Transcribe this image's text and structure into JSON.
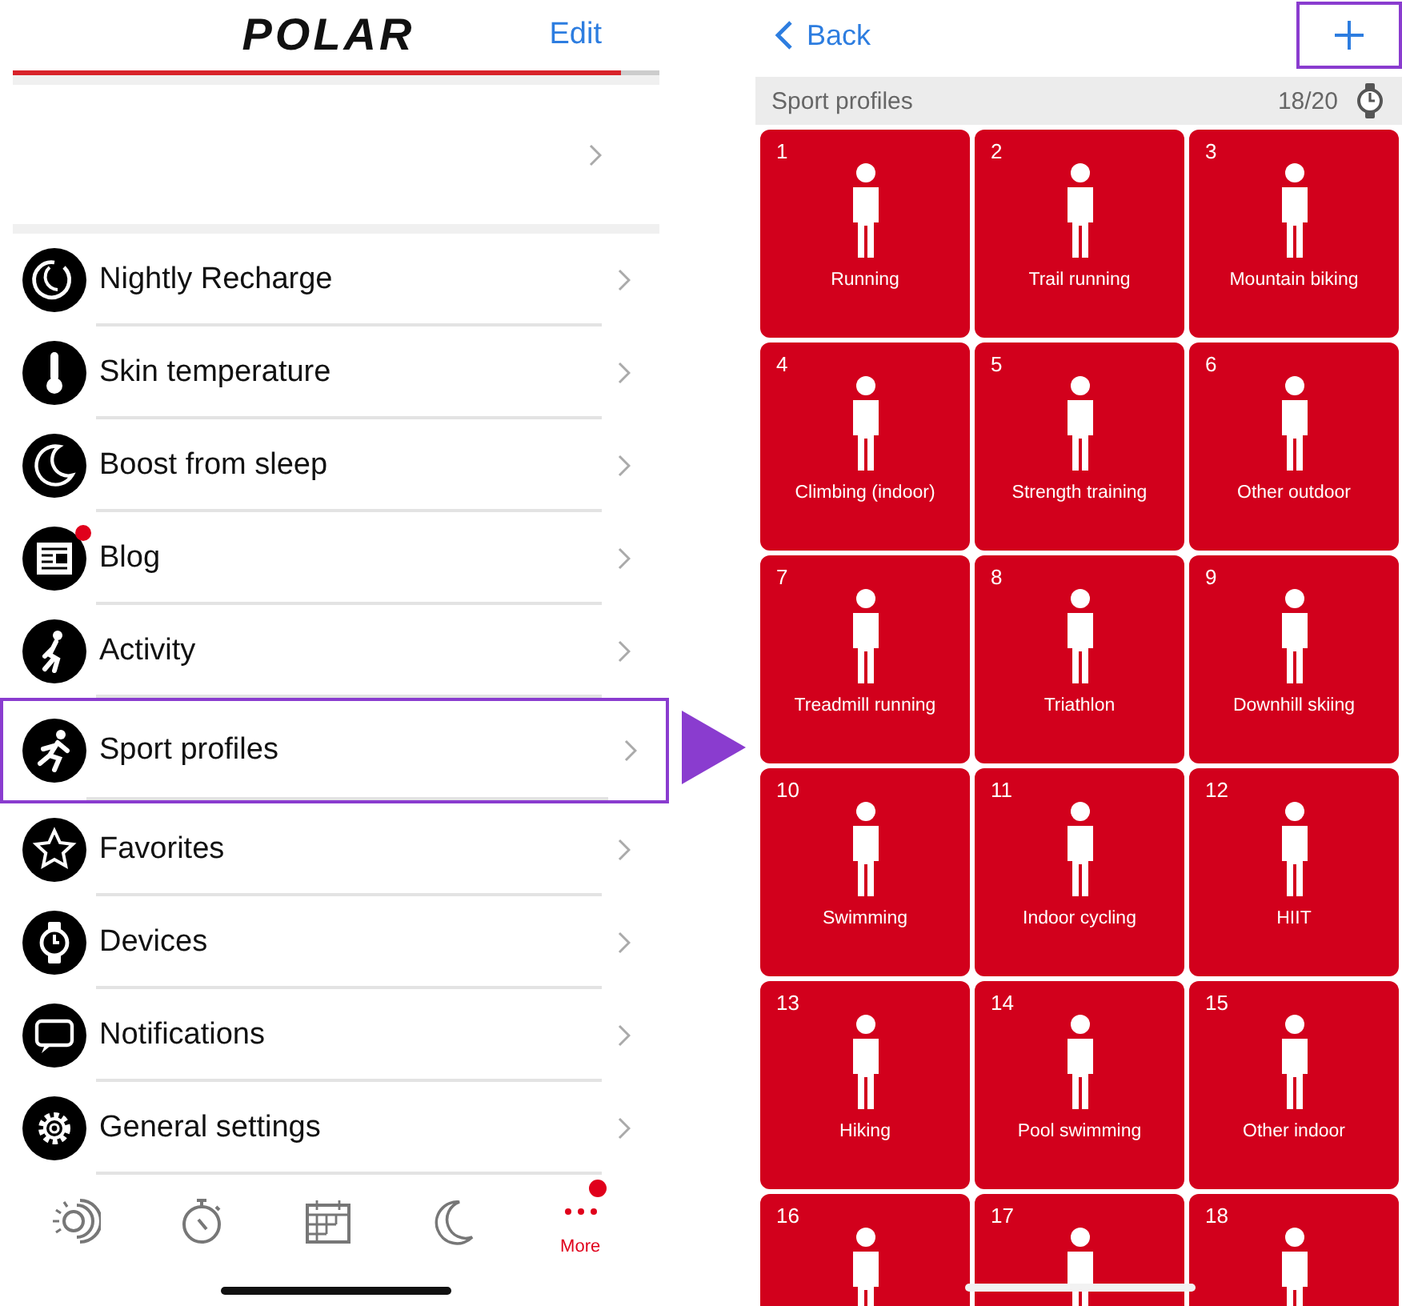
{
  "left": {
    "logo": "POLAR",
    "edit": "Edit",
    "menu": [
      {
        "label": "Nightly Recharge",
        "badge": false,
        "highlighted": false
      },
      {
        "label": "Skin temperature",
        "badge": false,
        "highlighted": false
      },
      {
        "label": "Boost from sleep",
        "badge": false,
        "highlighted": false
      },
      {
        "label": "Blog",
        "badge": true,
        "highlighted": false
      },
      {
        "label": "Activity",
        "badge": false,
        "highlighted": false
      },
      {
        "label": "Sport profiles",
        "badge": false,
        "highlighted": true
      },
      {
        "label": "Favorites",
        "badge": false,
        "highlighted": false
      },
      {
        "label": "Devices",
        "badge": false,
        "highlighted": false
      },
      {
        "label": "Notifications",
        "badge": false,
        "highlighted": false
      },
      {
        "label": "General settings",
        "badge": false,
        "highlighted": false
      }
    ],
    "tabs": [
      {
        "selected": false,
        "badge": false
      },
      {
        "selected": false,
        "badge": false
      },
      {
        "selected": false,
        "badge": false
      },
      {
        "selected": false,
        "badge": false
      },
      {
        "label": "More",
        "selected": true,
        "badge": true
      }
    ]
  },
  "right": {
    "back": "Back",
    "add_highlighted": true,
    "section": "Sport profiles",
    "count": "18/20",
    "profiles": [
      {
        "number": "1",
        "label": "Running"
      },
      {
        "number": "2",
        "label": "Trail running"
      },
      {
        "number": "3",
        "label": "Mountain biking"
      },
      {
        "number": "4",
        "label": "Climbing (indoor)"
      },
      {
        "number": "5",
        "label": "Strength training"
      },
      {
        "number": "6",
        "label": "Other outdoor"
      },
      {
        "number": "7",
        "label": "Treadmill running"
      },
      {
        "number": "8",
        "label": "Triathlon"
      },
      {
        "number": "9",
        "label": "Downhill skiing"
      },
      {
        "number": "10",
        "label": "Swimming"
      },
      {
        "number": "11",
        "label": "Indoor cycling"
      },
      {
        "number": "12",
        "label": "HIIT"
      },
      {
        "number": "13",
        "label": "Hiking"
      },
      {
        "number": "14",
        "label": "Pool swimming"
      },
      {
        "number": "15",
        "label": "Other indoor"
      },
      {
        "number": "16"
      },
      {
        "number": "17"
      },
      {
        "number": "18"
      }
    ]
  }
}
